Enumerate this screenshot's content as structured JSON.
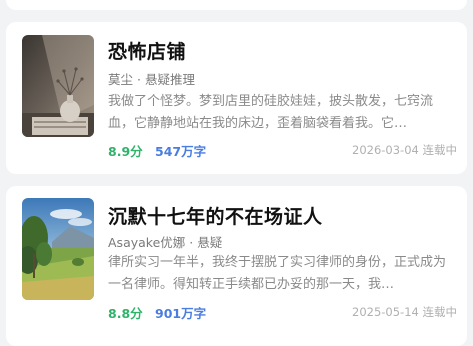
{
  "books": [
    {
      "title": "恐怖店铺",
      "author": "莫尘",
      "separator": " · ",
      "genre": "悬疑推理",
      "description": "我做了个怪梦。梦到店里的硅胶娃娃，披头散发，七窍流血，它静静地站在我的床边，歪着脑袋看着我。它…",
      "rating": "8.9分",
      "word_count": "547万字",
      "date": "2026-03-04",
      "status": "连载中",
      "cover_icon": "vase-still-life-cover"
    },
    {
      "title": "沉默十七年的不在场证人",
      "author": "Asayake优娜",
      "separator": " · ",
      "genre": "悬疑",
      "description": "律所实习一年半，我终于摆脱了实习律师的身份，正式成为一名律师。得知转正手续都已办妥的那一天，我…",
      "rating": "8.8分",
      "word_count": "901万字",
      "date": "2025-05-14",
      "status": "连载中",
      "cover_icon": "landscape-painting-cover"
    }
  ],
  "colors": {
    "rating": "#2fb36a",
    "word_count": "#4a7de0",
    "background": "#f2f3f5"
  }
}
